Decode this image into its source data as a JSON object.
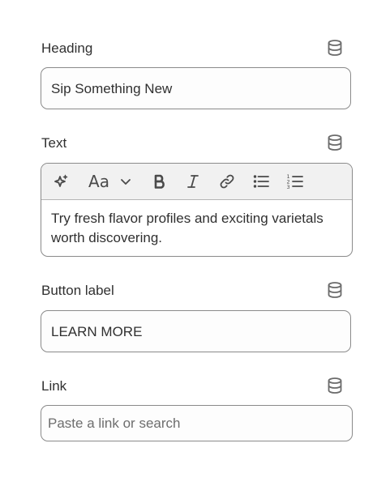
{
  "heading_field": {
    "label": "Heading",
    "value": "Sip Something New",
    "dynamic_source_icon": "database-icon"
  },
  "text_field": {
    "label": "Text",
    "dynamic_source_icon": "database-icon",
    "toolbar": {
      "ai_icon": "sparkle-icon",
      "text_style_glyph": "Aa",
      "text_style_dropdown_icon": "chevron-down-icon",
      "bold_icon": "bold-icon",
      "italic_icon": "italic-icon",
      "link_icon": "link-icon",
      "bulleted_list_icon": "bulleted-list-icon",
      "numbered_list_icon": "numbered-list-icon"
    },
    "value": "Try fresh flavor profiles and exciting varietals worth discovering."
  },
  "button_label_field": {
    "label": "Button label",
    "value": "LEARN MORE",
    "dynamic_source_icon": "database-icon"
  },
  "link_field": {
    "label": "Link",
    "placeholder": "Paste a link or search",
    "dynamic_source_icon": "database-icon"
  },
  "colors": {
    "text": "#303030",
    "border": "#8a8a8a",
    "toolbar_bg": "#f1f1f1",
    "icon": "#4a4a4a",
    "placeholder": "#6d6d6d"
  }
}
